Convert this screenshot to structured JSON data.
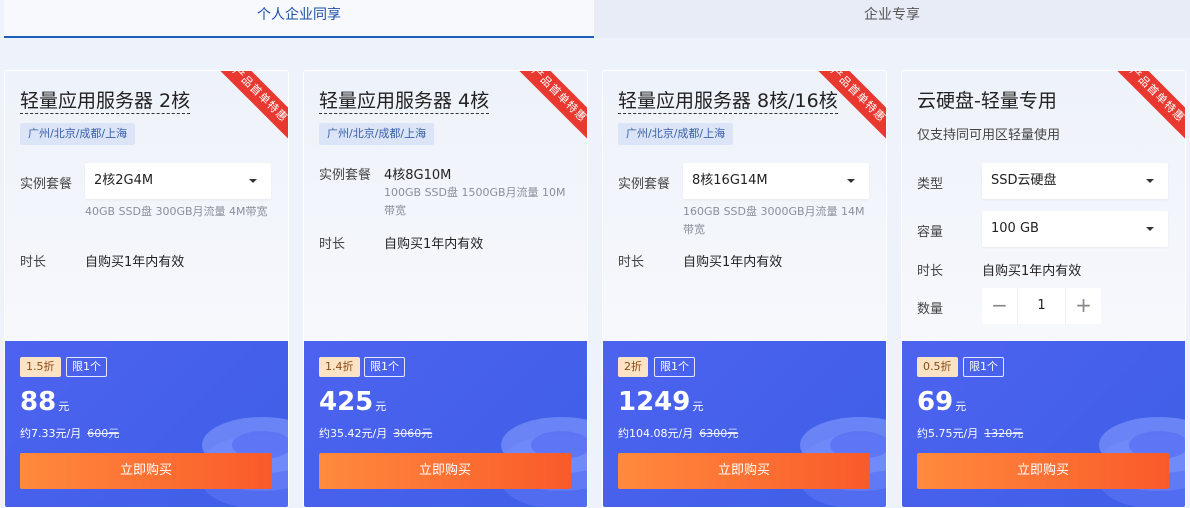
{
  "tabs": [
    {
      "label": "个人企业同享"
    },
    {
      "label": "企业专享"
    }
  ],
  "cards": [
    {
      "ribbon": "产品首单特惠",
      "title": "轻量应用服务器 2核",
      "region": "广州/北京/成都/上海",
      "spec_label": "实例套餐",
      "spec_value": "2核2G4M",
      "spec_desc": "40GB SSD盘 300GB月流量 4M带宽",
      "duration_label": "时长",
      "duration_value": "自购买1年内有效",
      "discount": "1.5折",
      "limit": "限1个",
      "price": "88",
      "price_unit": "元",
      "monthly": "约7.33元/月",
      "original": "600元",
      "buy_label": "立即购买"
    },
    {
      "ribbon": "产品首单特惠",
      "title": "轻量应用服务器 4核",
      "region": "广州/北京/成都/上海",
      "spec_label": "实例套餐",
      "spec_value": "4核8G10M",
      "spec_desc": "100GB SSD盘 1500GB月流量 10M带宽",
      "duration_label": "时长",
      "duration_value": "自购买1年内有效",
      "discount": "1.4折",
      "limit": "限1个",
      "price": "425",
      "price_unit": "元",
      "monthly": "约35.42元/月",
      "original": "3060元",
      "buy_label": "立即购买"
    },
    {
      "ribbon": "产品首单特惠",
      "title": "轻量应用服务器 8核/16核",
      "region": "广州/北京/成都/上海",
      "spec_label": "实例套餐",
      "spec_value": "8核16G14M",
      "spec_desc": "160GB SSD盘 3000GB月流量 14M带宽",
      "duration_label": "时长",
      "duration_value": "自购买1年内有效",
      "discount": "2折",
      "limit": "限1个",
      "price": "1249",
      "price_unit": "元",
      "monthly": "约104.08元/月",
      "original": "6300元",
      "buy_label": "立即购买"
    },
    {
      "ribbon": "产品首单特惠",
      "title": "云硬盘-轻量专用",
      "subtitle": "仅支持同可用区轻量使用",
      "type_label": "类型",
      "type_value": "SSD云硬盘",
      "capacity_label": "容量",
      "capacity_value": "100 GB",
      "duration_label": "时长",
      "duration_value": "自购买1年内有效",
      "quantity_label": "数量",
      "quantity_value": "1",
      "discount": "0.5折",
      "limit": "限1个",
      "price": "69",
      "price_unit": "元",
      "monthly": "约5.75元/月",
      "original": "1320元",
      "buy_label": "立即购买"
    }
  ],
  "colors": {
    "accent_blue": "#4d63f0",
    "buy_orange": "#f95a2a",
    "ribbon_red": "#e8382f"
  }
}
